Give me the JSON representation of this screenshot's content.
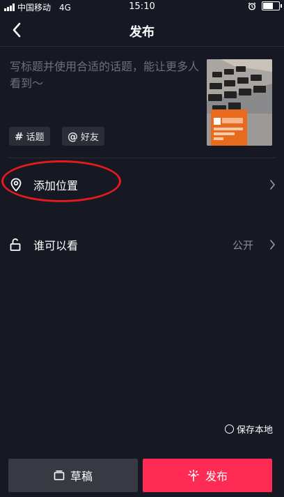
{
  "status_bar": {
    "carrier": "中国移动",
    "network": "4G",
    "time": "15:10",
    "battery_level": 0.65
  },
  "header": {
    "title": "发布"
  },
  "caption": {
    "placeholder": "写标题并使用合适的话题，能让更多人看到～"
  },
  "tags": [
    {
      "symbol": "#",
      "label": "话题"
    },
    {
      "symbol": "@",
      "label": "好友"
    }
  ],
  "options": {
    "location": {
      "label": "添加位置"
    },
    "privacy": {
      "label": "谁可以看",
      "value": "公开"
    }
  },
  "save_local": {
    "label": "保存本地"
  },
  "actions": {
    "draft_label": "草稿",
    "publish_label": "发布"
  },
  "colors": {
    "background": "#161823",
    "accent": "#fe2c55",
    "annotation": "#e41b1b"
  }
}
